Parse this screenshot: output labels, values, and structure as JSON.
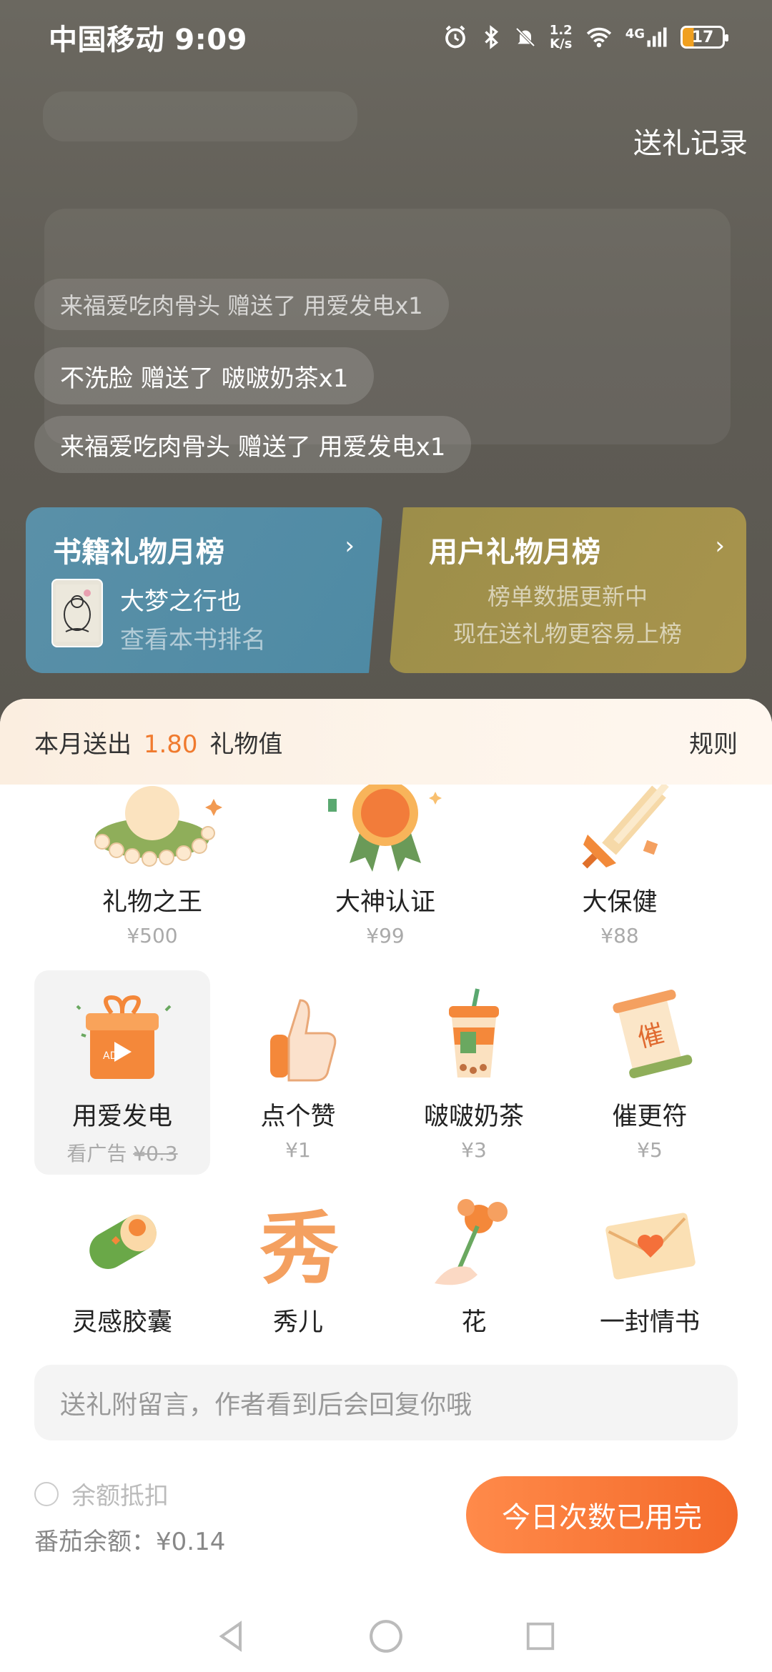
{
  "status_bar": {
    "carrier_time": "中国移动 9:09",
    "speed_value": "1.2",
    "speed_unit": "K/s",
    "network": "4G",
    "battery": "17"
  },
  "header": {
    "record_link": "送礼记录"
  },
  "barrage": [
    {
      "text": "来福爱吃肉骨头 赠送了 用爱发电x1"
    },
    {
      "text": "不洗脸 赠送了 啵啵奶茶x1"
    },
    {
      "text": "来福爱吃肉骨头 赠送了 用爱发电x1"
    }
  ],
  "book_rank": {
    "title": "书籍礼物月榜",
    "book_name": "大梦之行也",
    "subtitle": "查看本书排名",
    "color": "#5a90a8"
  },
  "user_rank": {
    "title": "用户礼物月榜",
    "line1": "榜单数据更新中",
    "line2": "现在送礼物更容易上榜",
    "color": "#a8944c"
  },
  "sheet": {
    "sent_prefix": "本月送出",
    "sent_value": "1.80",
    "sent_suffix": "礼物值",
    "rules": "规则",
    "accent": "#f07a2e"
  },
  "gifts_row1": [
    {
      "name": "礼物之王",
      "price": "¥500",
      "icon": "pearl-crown-icon"
    },
    {
      "name": "大神认证",
      "price": "¥99",
      "icon": "medal-icon"
    },
    {
      "name": "大保健",
      "price": "¥88",
      "icon": "sword-icon"
    }
  ],
  "gifts_row2": [
    {
      "name": "用爱发电",
      "price_prefix": "看广告",
      "price": "¥0.3",
      "icon": "ad-giftbox-icon",
      "selected": true
    },
    {
      "name": "点个赞",
      "price": "¥1",
      "icon": "thumbs-up-icon"
    },
    {
      "name": "啵啵奶茶",
      "price": "¥3",
      "icon": "bubble-tea-icon"
    },
    {
      "name": "催更符",
      "price": "¥5",
      "icon": "scroll-talisman-icon"
    }
  ],
  "gifts_row3": [
    {
      "name": "灵感胶囊",
      "icon": "capsule-icon"
    },
    {
      "name": "秀儿",
      "icon": "xiu-character-icon"
    },
    {
      "name": "花",
      "icon": "flower-icon"
    },
    {
      "name": "一封情书",
      "icon": "love-letter-icon"
    }
  ],
  "message": {
    "placeholder": "送礼附留言，作者看到后会回复你哦"
  },
  "balance": {
    "deduct_label": "余额抵扣",
    "balance_text": "番茄余额：¥0.14"
  },
  "send_button": {
    "label": "今日次数已用完"
  }
}
